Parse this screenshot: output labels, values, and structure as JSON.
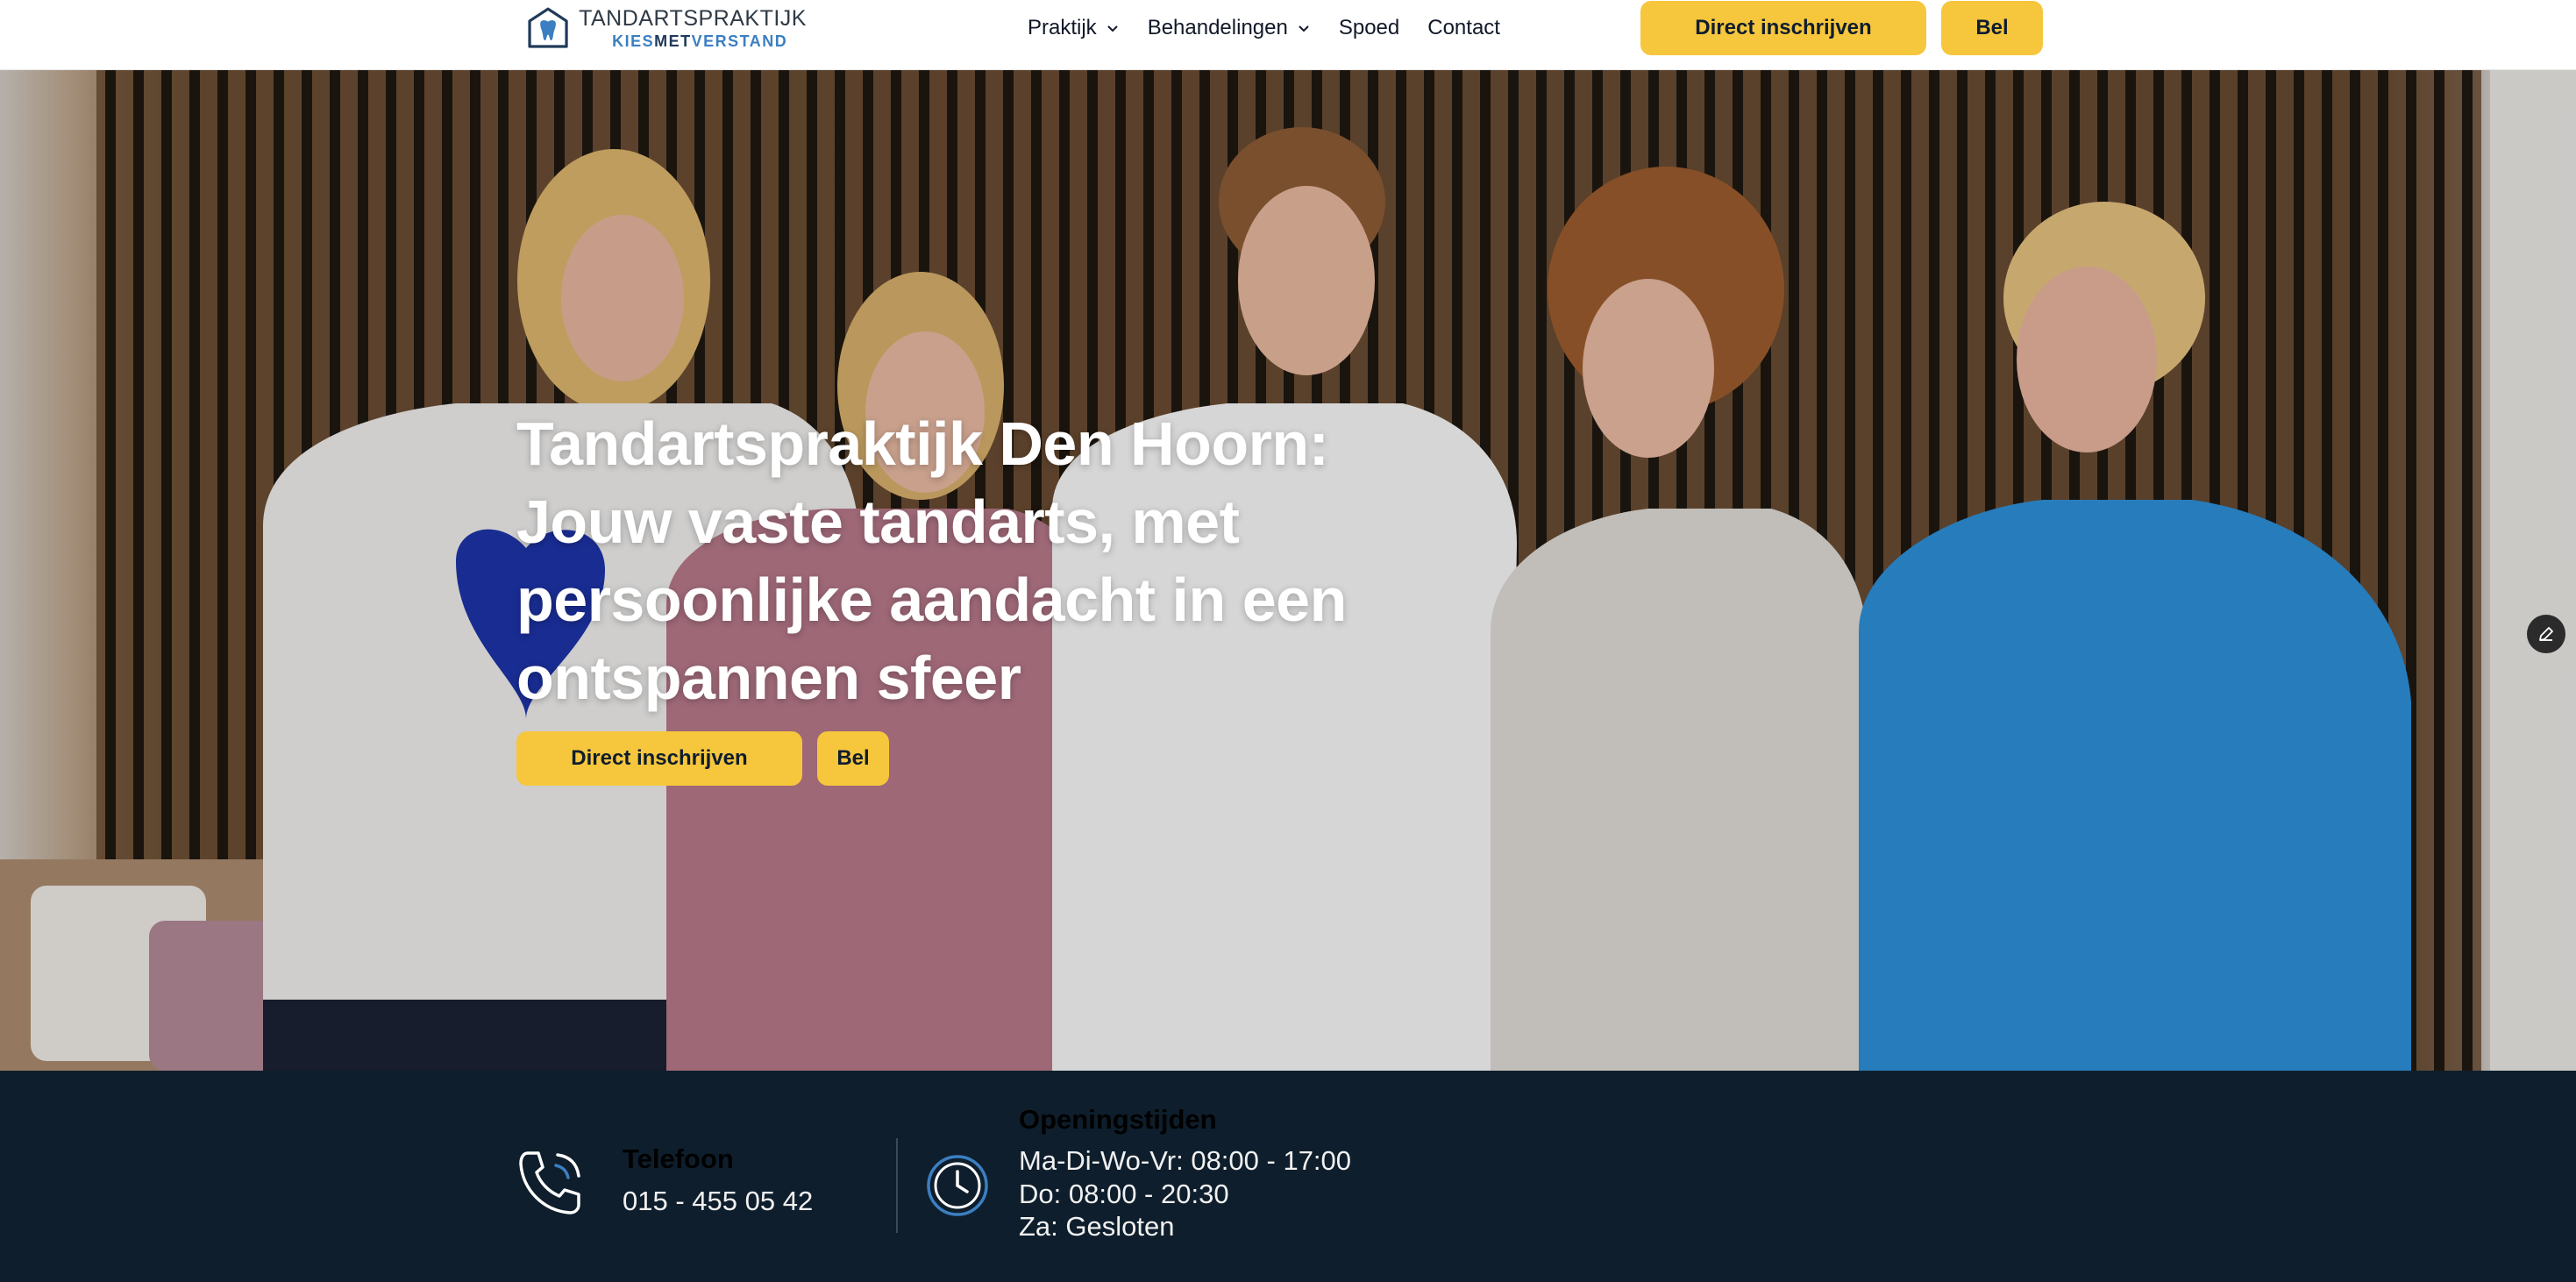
{
  "header": {
    "logo": {
      "name": "TANDARTSPRAKTIJK",
      "tagline_pre": "KIES",
      "tagline_mid": "MET",
      "tagline_post": "VERSTAND"
    },
    "nav": [
      {
        "label": "Praktijk",
        "has_dropdown": true
      },
      {
        "label": "Behandelingen",
        "has_dropdown": true
      },
      {
        "label": "Spoed",
        "has_dropdown": false
      },
      {
        "label": "Contact",
        "has_dropdown": false
      }
    ],
    "enroll_label": "Direct inschrijven",
    "call_label": "Bel"
  },
  "hero": {
    "title_lines": [
      "Tandartspraktijk Den Hoorn:",
      "Jouw vaste tandarts, met",
      "persoonlijke aandacht in een",
      "ontspannen sfeer"
    ],
    "enroll_label": "Direct inschrijven",
    "call_label": "Bel"
  },
  "contact": {
    "phone_label": "Telefoon",
    "phone_value": "015 - 455 05 42",
    "hours_label": "Openingstijden",
    "hours": [
      "Ma-Di-Wo-Vr: 08:00 - 17:00",
      "Do: 08:00 - 20:30",
      "Za: Gesloten"
    ]
  },
  "colors": {
    "accent": "#f6c63d",
    "dark": "#0e1e2c",
    "brand_blue": "#3b7fc1"
  },
  "icons": [
    "tooth-logo-icon",
    "chevron-down-icon",
    "phone-icon",
    "clock-icon",
    "edit-pencil-icon"
  ]
}
